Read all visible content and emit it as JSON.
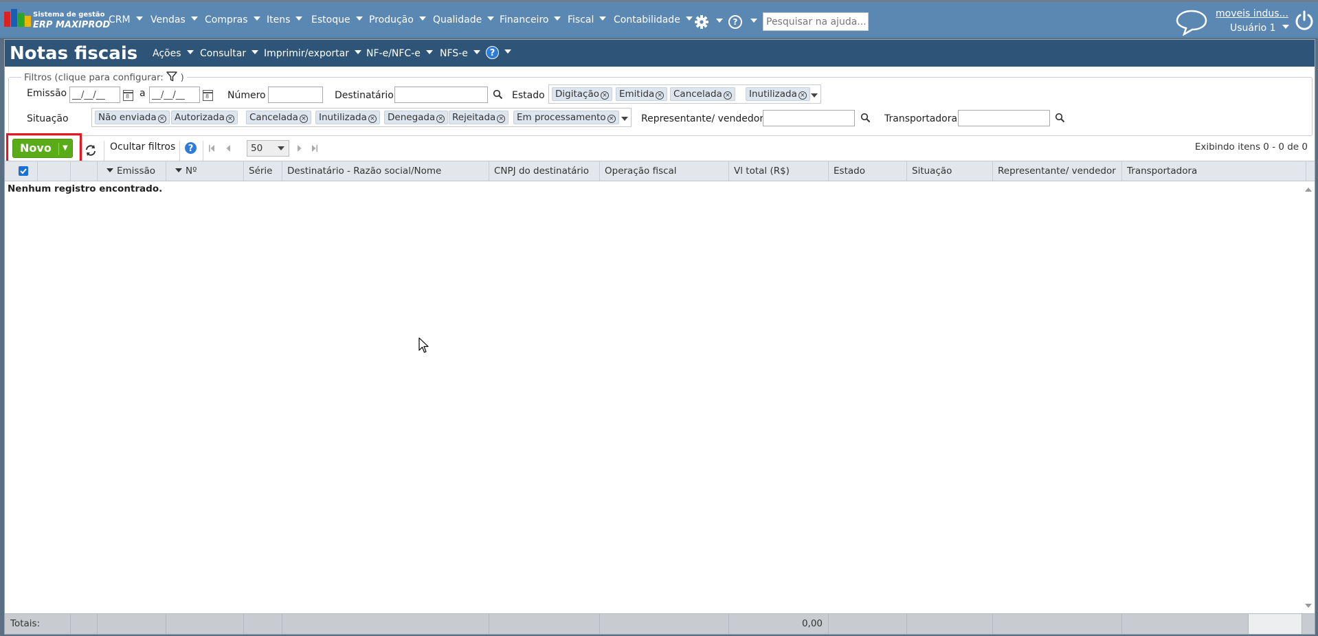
{
  "brand": {
    "line1": "Sistema de gestão",
    "line2": "ERP MAXIPROD",
    "colors": [
      "#e02020",
      "#1a5fb4",
      "#2aa52a",
      "#f0b400"
    ]
  },
  "nav": {
    "items": [
      "CRM",
      "Vendas",
      "Compras",
      "Itens",
      "Estoque",
      "Produção",
      "Qualidade",
      "Financeiro",
      "Fiscal",
      "Contabilidade"
    ],
    "help_glyph": "?",
    "search_placeholder": "Pesquisar na ajuda...",
    "company": "moveis indus...",
    "user": "Usuário 1"
  },
  "page": {
    "title": "Notas fiscais",
    "menus": [
      "Ações",
      "Consultar",
      "Imprimir/exportar",
      "NF-e/NFC-e",
      "NFS-e"
    ],
    "help_glyph": "?"
  },
  "filters": {
    "legend": "Filtros (clique para configurar:",
    "legend_close": ")",
    "emissao_label": "Emissão",
    "date_from": "__/__/__",
    "date_sep": "a",
    "date_to": "__/__/__",
    "numero_label": "Número",
    "destinatario_label": "Destinatário",
    "estado_label": "Estado",
    "estado_tags": [
      "Digitação",
      "Emitida",
      "Cancelada",
      "Inutilizada"
    ],
    "situacao_label": "Situação",
    "situacao_tags": [
      "Não enviada",
      "Autorizada",
      "Cancelada",
      "Inutilizada",
      "Denegada",
      "Rejeitada",
      "Em processamento"
    ],
    "representante_label": "Representante/ vendedor",
    "transportadora_label": "Transportadora",
    "tag_remove_glyph": "×"
  },
  "toolbar": {
    "novo": "Novo",
    "novo_arrow": "▼",
    "hide_filters": "Ocultar filtros",
    "help_glyph": "?",
    "page_size": "50",
    "showing": "Exibindo itens 0 - 0 de 0"
  },
  "grid": {
    "columns": [
      "",
      "",
      "Emissão",
      "Nº",
      "Série",
      "Destinatário - Razão social/Nome",
      "CNPJ do destinatário",
      "Operação fiscal",
      "Vl total (R$)",
      "Estado",
      "Situação",
      "Representante/ vendedor",
      "Transportadora"
    ],
    "empty_message": "Nenhum registro encontrado.",
    "totals_label": "Totais:",
    "totals_value": "0,00"
  }
}
